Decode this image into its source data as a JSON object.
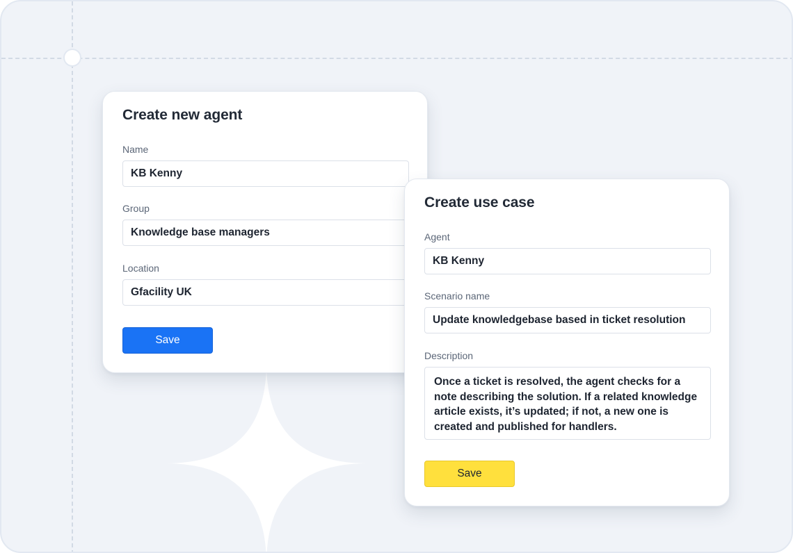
{
  "agent_form": {
    "title": "Create new agent",
    "name_label": "Name",
    "name_value": "KB Kenny",
    "group_label": "Group",
    "group_value": "Knowledge base managers",
    "location_label": "Location",
    "location_value": "Gfacility UK",
    "save_label": "Save"
  },
  "use_case_form": {
    "title": "Create use case",
    "agent_label": "Agent",
    "agent_value": "KB Kenny",
    "scenario_label": "Scenario name",
    "scenario_value": "Update knowledgebase based in ticket resolution",
    "description_label": "Description",
    "description_value": "Once a ticket is resolved, the agent checks for a note describing the solution. If a related knowledge article exists, it’s updated; if not, a new one is created and published for handlers.",
    "save_label": "Save"
  },
  "colors": {
    "background": "#f0f3f8",
    "primary_button": "#1a73f5",
    "accent_button": "#ffe03d"
  },
  "icons": {
    "decoration": "sparkle-icon",
    "grid_node": "grid-node"
  }
}
